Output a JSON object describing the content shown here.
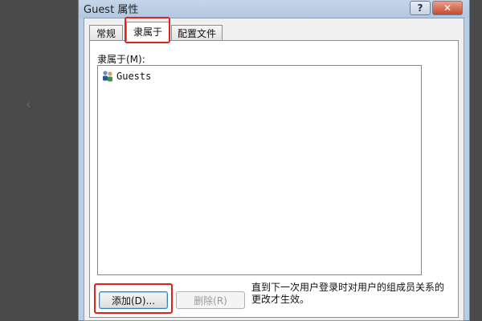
{
  "window": {
    "title": "Guest 属性",
    "help_label": "?",
    "close_label": "✕"
  },
  "tabs": [
    {
      "label": "常规"
    },
    {
      "label": "隶属于"
    },
    {
      "label": "配置文件"
    }
  ],
  "member_of": {
    "label": "隶属于(M):",
    "groups": [
      {
        "name": "Guests",
        "icon": "user-group-icon"
      }
    ]
  },
  "buttons": {
    "add_label": "添加(D)...",
    "remove_label": "删除(R)"
  },
  "note": "直到下一次用户登录时对用户的组成员关系的更改才生效。",
  "colors": {
    "highlight": "#e0231a",
    "title_bar": "#b9cde4",
    "close_button": "#c64a2b"
  }
}
